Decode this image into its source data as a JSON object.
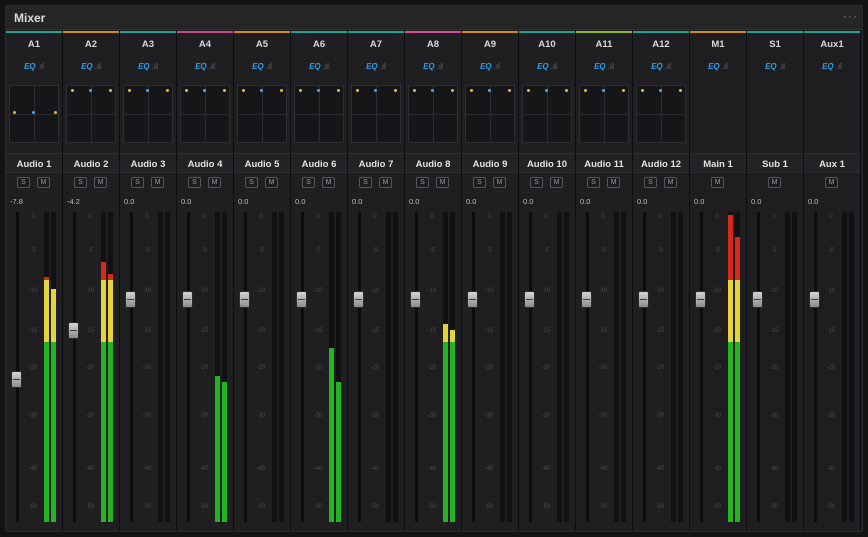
{
  "window": {
    "title": "Mixer",
    "menu_icon": "ellipsis-icon",
    "menu_glyph": "···"
  },
  "eq_label": "EQ",
  "eq_bars_glyph": ".ıl",
  "scale_labels": [
    "0",
    "-5",
    "-10",
    "-15",
    "-20",
    "-30",
    "-40",
    "-50"
  ],
  "colors": {
    "meter_green": "#22b521",
    "meter_yellow": "#e5d33a",
    "meter_red": "#d42a1c",
    "eq_blue": "#2d9ee6",
    "pan_dot_yellow": "#e0b84a",
    "pan_dot_blue": "#4aa6e8"
  },
  "channels": [
    {
      "track": "A1",
      "name": "Audio 1",
      "level": "-7.8",
      "solo": "S",
      "mute": "M",
      "accent": "#1fa39a",
      "fader": 0.46,
      "meters": [
        0.79,
        0.75
      ],
      "pan": true
    },
    {
      "track": "A2",
      "name": "Audio 2",
      "level": "-4.2",
      "solo": "S",
      "mute": "M",
      "accent": "#d58a1f",
      "fader": 0.62,
      "meters": [
        0.84,
        0.8
      ],
      "pan": true
    },
    {
      "track": "A3",
      "name": "Audio 3",
      "level": "0.0",
      "solo": "S",
      "mute": "M",
      "accent": "#1fa39a",
      "fader": 0.72,
      "meters": [
        0,
        0
      ],
      "pan": true
    },
    {
      "track": "A4",
      "name": "Audio 4",
      "level": "0.0",
      "solo": "S",
      "mute": "M",
      "accent": "#c44d8f",
      "fader": 0.72,
      "meters": [
        0.47,
        0.45
      ],
      "pan": true
    },
    {
      "track": "A5",
      "name": "Audio 5",
      "level": "0.0",
      "solo": "S",
      "mute": "M",
      "accent": "#d58a1f",
      "fader": 0.72,
      "meters": [
        0,
        0
      ],
      "pan": true
    },
    {
      "track": "A6",
      "name": "Audio 6",
      "level": "0.0",
      "solo": "S",
      "mute": "M",
      "accent": "#1fa39a",
      "fader": 0.72,
      "meters": [
        0.56,
        0.45
      ],
      "pan": true
    },
    {
      "track": "A7",
      "name": "Audio 7",
      "level": "0.0",
      "solo": "S",
      "mute": "M",
      "accent": "#1fa39a",
      "fader": 0.72,
      "meters": [
        0,
        0
      ],
      "pan": true
    },
    {
      "track": "A8",
      "name": "Audio 8",
      "level": "0.0",
      "solo": "S",
      "mute": "M",
      "accent": "#d64f9f",
      "fader": 0.72,
      "meters": [
        0.64,
        0.62
      ],
      "pan": true
    },
    {
      "track": "A9",
      "name": "Audio 9",
      "level": "0.0",
      "solo": "S",
      "mute": "M",
      "accent": "#d58a1f",
      "fader": 0.72,
      "meters": [
        0,
        0
      ],
      "pan": true
    },
    {
      "track": "A10",
      "name": "Audio 10",
      "level": "0.0",
      "solo": "S",
      "mute": "M",
      "accent": "#1fa39a",
      "fader": 0.72,
      "meters": [
        0,
        0
      ],
      "pan": true
    },
    {
      "track": "A11",
      "name": "Audio 11",
      "level": "0.0",
      "solo": "S",
      "mute": "M",
      "accent": "#8fb42a",
      "fader": 0.72,
      "meters": [
        0,
        0
      ],
      "pan": true
    },
    {
      "track": "A12",
      "name": "Audio 12",
      "level": "0.0",
      "solo": "S",
      "mute": "M",
      "accent": "#1fa39a",
      "fader": 0.72,
      "meters": [
        0,
        0
      ],
      "pan": true
    },
    {
      "track": "M1",
      "name": "Main 1",
      "level": "0.0",
      "solo": "",
      "mute": "M",
      "accent": "#d58a1f",
      "fader": 0.72,
      "meters": [
        0.99,
        0.92
      ],
      "pan": false
    },
    {
      "track": "S1",
      "name": "Sub 1",
      "level": "0.0",
      "solo": "",
      "mute": "M",
      "accent": "#1fa39a",
      "fader": 0.72,
      "meters": [
        0,
        0
      ],
      "pan": false
    },
    {
      "track": "Aux1",
      "name": "Aux 1",
      "level": "0.0",
      "solo": "",
      "mute": "M",
      "accent": "#1fa39a",
      "fader": 0.72,
      "meters": [
        0,
        0
      ],
      "pan": false
    }
  ]
}
